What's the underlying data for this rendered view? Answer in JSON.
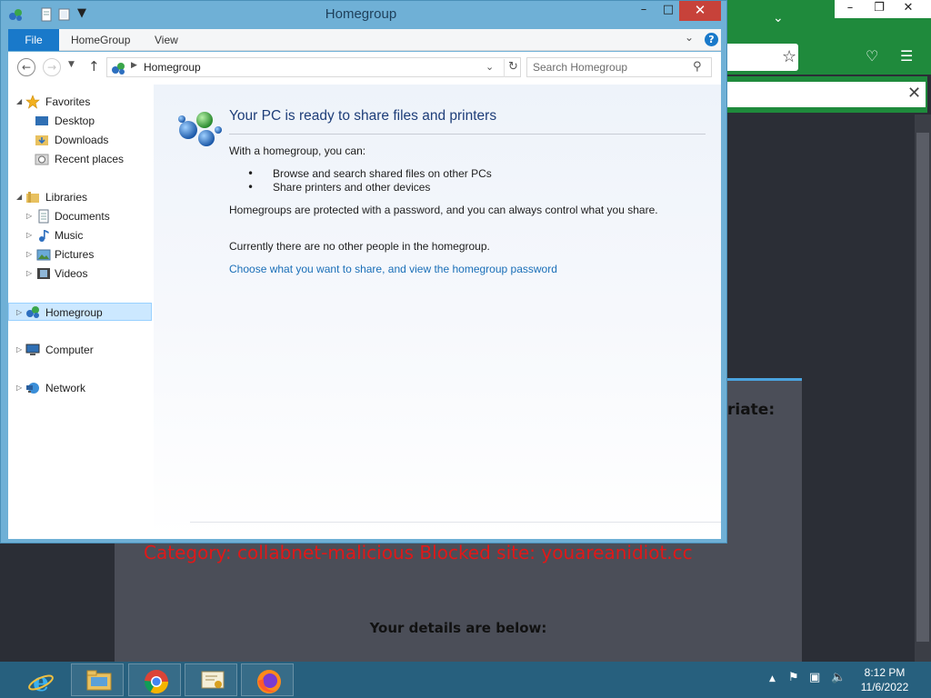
{
  "window": {
    "title": "Homegroup",
    "ribbon_tabs": [
      "File",
      "HomeGroup",
      "View"
    ],
    "help_label": "?"
  },
  "address_bar": {
    "path": "Homegroup",
    "search_placeholder": "Search Homegroup"
  },
  "nav_pane": {
    "favorites": {
      "label": "Favorites",
      "items": [
        "Desktop",
        "Downloads",
        "Recent places"
      ]
    },
    "libraries": {
      "label": "Libraries",
      "items": [
        "Documents",
        "Music",
        "Pictures",
        "Videos"
      ]
    },
    "homegroup": "Homegroup",
    "computer": "Computer",
    "network": "Network",
    "selected": "Homegroup"
  },
  "main": {
    "heading": "Your PC is ready to share files and printers",
    "intro": "With a homegroup, you can:",
    "bullets": [
      "Browse and search shared files on other PCs",
      "Share printers and other devices"
    ],
    "protected_text": "Homegroups are protected with a password, and you can always control what you share.",
    "status_text": "Currently there are no other people in the homegroup.",
    "link": "Choose what you want to share, and view the homegroup password"
  },
  "background_page": {
    "partial_heading": "riate:",
    "category_text": "Category: collabnet-malicious  Blocked site: youareanidiot.cc",
    "details_heading": "Your details are below:"
  },
  "taskbar": {
    "apps": [
      "internet-explorer",
      "file-explorer",
      "chrome",
      "certificate-app",
      "firefox"
    ],
    "time": "8:12 PM",
    "date": "11/6/2022"
  },
  "colors": {
    "accent": "#1979ca",
    "window_frame": "#6fb0d6",
    "close_button": "#c7423a",
    "taskbar": "#27607e",
    "browser_green": "#1f8a3c",
    "blocked_red": "#e01818",
    "link_blue": "#1a6fb8"
  }
}
